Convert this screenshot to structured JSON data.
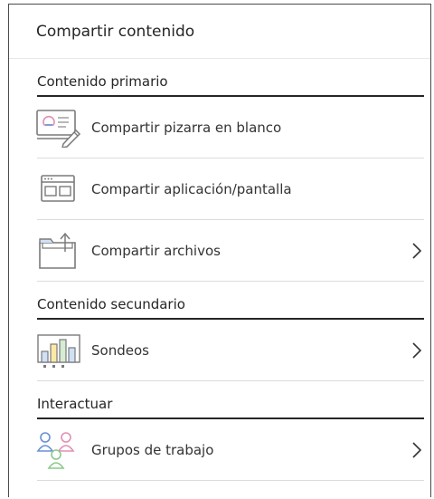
{
  "header": {
    "title": "Compartir contenido"
  },
  "sections": [
    {
      "title": "Contenido primario",
      "items": [
        {
          "label": "Compartir pizarra en blanco",
          "icon": "whiteboard-icon"
        },
        {
          "label": "Compartir aplicación/pantalla",
          "icon": "application-window-icon"
        },
        {
          "label": "Compartir archivos",
          "icon": "folder-upload-icon",
          "chevron": true
        }
      ]
    },
    {
      "title": "Contenido secundario",
      "items": [
        {
          "label": "Sondeos",
          "icon": "poll-chart-icon",
          "chevron": true
        }
      ]
    },
    {
      "title": "Interactuar",
      "items": [
        {
          "label": "Grupos de trabajo",
          "icon": "groups-people-icon",
          "chevron": true
        }
      ]
    }
  ],
  "colors": {
    "text": "#262626",
    "icon_gray": "#7a7a7a",
    "divider_strong": "#262626",
    "divider_light": "#dcdcdc",
    "accent_blue": "#6a8fd6",
    "accent_pink": "#e08fb4",
    "accent_yellow": "#f2d25c",
    "accent_green": "#8cc98a"
  }
}
